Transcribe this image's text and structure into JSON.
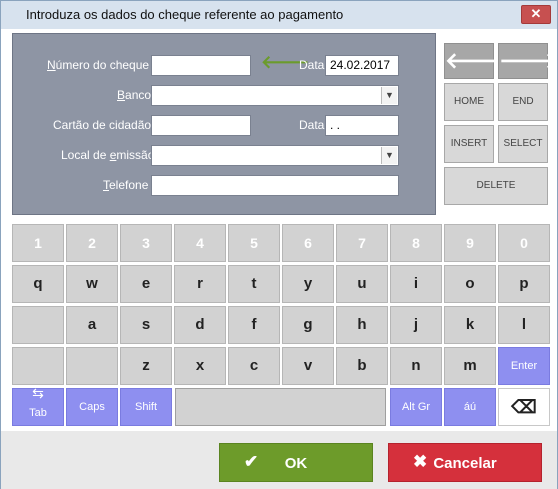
{
  "window": {
    "title": "Introduza os dados do cheque referente ao pagamento",
    "close_label": "✕"
  },
  "form": {
    "numero_label_first": "N",
    "numero_label_rest": "úmero do cheque",
    "numero_value": "",
    "arrow_icon": "left-arrow-icon",
    "data_label": "Data",
    "data_value": "24.02.2017",
    "banco_label_first": "B",
    "banco_label_rest": "anco",
    "banco_value": "",
    "cartao_label": "Cartão de cidadão",
    "cartao_value": "",
    "data2_label": "Data",
    "data2_value": " .  .",
    "local_label_first": "Local de ",
    "local_label_underlined": "e",
    "local_label_rest": "missão",
    "local_value": "",
    "telefone_label_first": "T",
    "telefone_label_rest": "elefone",
    "telefone_value": "",
    "dropdown_glyph": "▼"
  },
  "side_buttons": {
    "back_glyph": "🡐",
    "forward_glyph": "🡒",
    "home": "HOME",
    "end": "END",
    "insert": "INSERT",
    "select": "SELECT",
    "delete": "DELETE"
  },
  "keyboard": {
    "row1": [
      "1",
      "2",
      "3",
      "4",
      "5",
      "6",
      "7",
      "8",
      "9",
      "0"
    ],
    "row2": [
      "q",
      "w",
      "e",
      "r",
      "t",
      "y",
      "u",
      "i",
      "o",
      "p"
    ],
    "row3": [
      "",
      "a",
      "s",
      "d",
      "f",
      "g",
      "h",
      "j",
      "k",
      "l"
    ],
    "row4": [
      "",
      "",
      "z",
      "x",
      "c",
      "v",
      "b",
      "n",
      "m",
      "Enter"
    ],
    "tab": "Tab",
    "caps": "Caps",
    "shift": "Shift",
    "altgr": "Alt Gr",
    "accent": "áú",
    "backspace_glyph": "⌫"
  },
  "footer": {
    "ok_label": "OK",
    "ok_glyph": "✔",
    "cancel_label": "Cancelar",
    "cancel_glyph": "✖"
  },
  "colors": {
    "ok": "#6d9b2a",
    "cancel": "#d5303c",
    "blue_key": "#8e8ff0",
    "panel": "#8e95a4"
  }
}
